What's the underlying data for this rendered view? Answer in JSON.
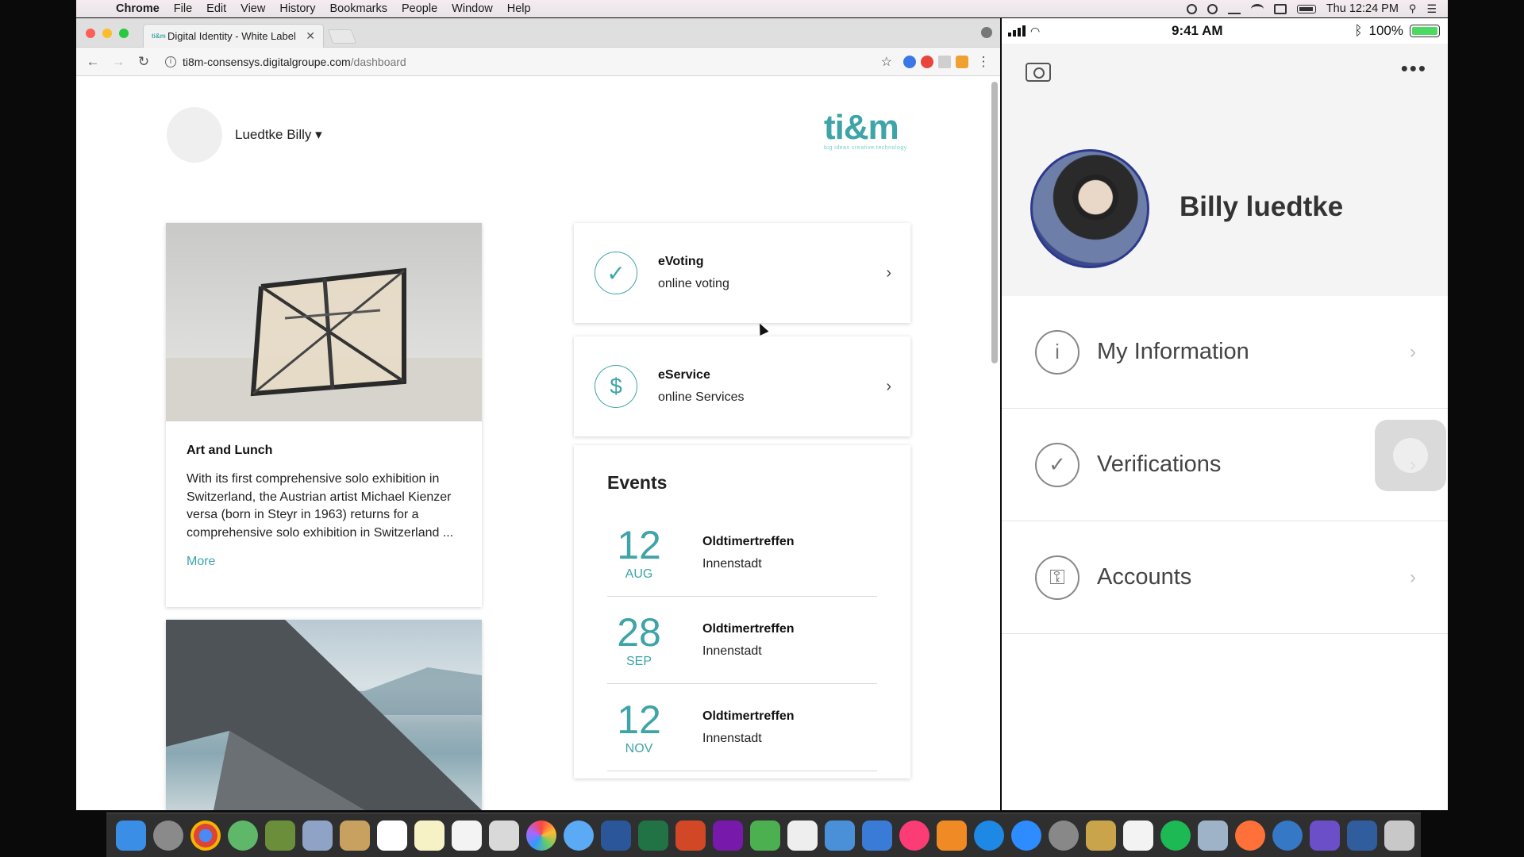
{
  "menubar": {
    "app": "Chrome",
    "items": [
      "File",
      "Edit",
      "View",
      "History",
      "Bookmarks",
      "People",
      "Window",
      "Help"
    ],
    "clock": "Thu 12:24 PM"
  },
  "browser": {
    "tab_title": "Digital Identity - White Label",
    "tab_favicon": "ti&m",
    "url_host": "ti8m-consensys.digitalgroupe.com",
    "url_path": "/dashboard"
  },
  "dashboard": {
    "user_name": "Luedtke Billy ▾",
    "logo": "ti&m",
    "logo_tagline": "big ideas creative technology",
    "article": {
      "title": "Art and Lunch",
      "text": "With its first comprehensive solo exhibition in Switzerland, the Austrian artist Michael Kienzer versa (born in Steyr in 1963) returns for a comprehensive solo exhibition in Switzerland ...",
      "more": "More"
    },
    "services": [
      {
        "title": "eVoting",
        "subtitle": "online voting",
        "icon": "check-icon"
      },
      {
        "title": "eService",
        "subtitle": "online Services",
        "icon": "dollar-icon"
      }
    ],
    "events_title": "Events",
    "events": [
      {
        "day": "12",
        "month": "AUG",
        "name": "Oldtimertreffen",
        "location": "Innenstadt"
      },
      {
        "day": "28",
        "month": "SEP",
        "name": "Oldtimertreffen",
        "location": "Innenstadt"
      },
      {
        "day": "12",
        "month": "NOV",
        "name": "Oldtimertreffen",
        "location": "Innenstadt"
      }
    ],
    "accent_color": "#3ea4a8"
  },
  "phone": {
    "time": "9:41 AM",
    "battery": "100%",
    "profile_name": "Billy luedtke",
    "menu": [
      {
        "label": "My Information",
        "icon": "info-icon"
      },
      {
        "label": "Verifications",
        "icon": "check-icon"
      },
      {
        "label": "Accounts",
        "icon": "lock-icon"
      }
    ]
  }
}
